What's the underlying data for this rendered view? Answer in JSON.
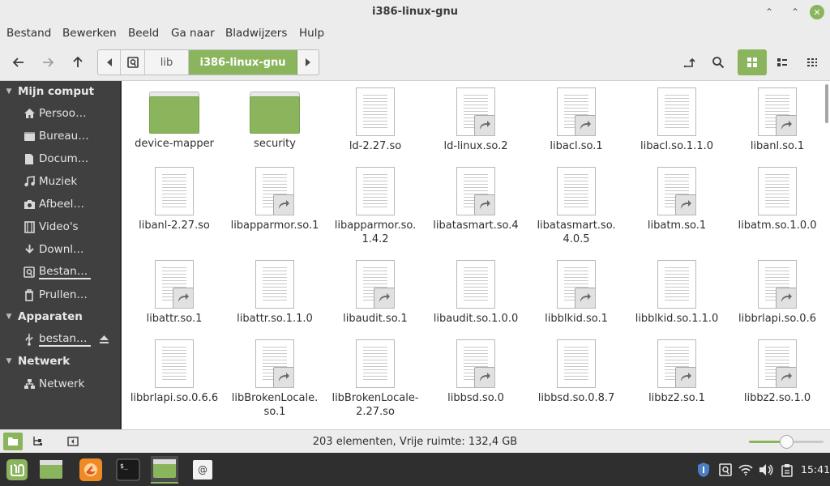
{
  "window": {
    "title": "i386-linux-gnu"
  },
  "menu": [
    "Bestand",
    "Bewerken",
    "Beeld",
    "Ga naar",
    "Bladwijzers",
    "Hulp"
  ],
  "pathbar": {
    "segments": [
      "lib",
      "i386-linux-gnu"
    ]
  },
  "sidebar": {
    "sections": [
      {
        "title": "Mijn comput",
        "items": [
          {
            "label": "Persoo…",
            "icon": "home-icon"
          },
          {
            "label": "Bureau…",
            "icon": "desktop-icon"
          },
          {
            "label": "Docum…",
            "icon": "document-icon"
          },
          {
            "label": "Muziek",
            "icon": "music-icon"
          },
          {
            "label": "Afbeel…",
            "icon": "camera-icon"
          },
          {
            "label": "Video's",
            "icon": "film-icon"
          },
          {
            "label": "Downl…",
            "icon": "download-icon"
          },
          {
            "label": "Bestan…",
            "icon": "filesystem-icon"
          },
          {
            "label": "Prullen…",
            "icon": "trash-icon"
          }
        ]
      },
      {
        "title": "Apparaten",
        "items": [
          {
            "label": "bestan…",
            "icon": "usb-icon"
          }
        ]
      },
      {
        "title": "Netwerk",
        "items": [
          {
            "label": "Netwerk",
            "icon": "network-icon"
          }
        ]
      }
    ]
  },
  "files": [
    {
      "name": "device-mapper",
      "type": "folder"
    },
    {
      "name": "security",
      "type": "folder"
    },
    {
      "name": "ld-2.27.so",
      "type": "file"
    },
    {
      "name": "ld-linux.so.2",
      "type": "link"
    },
    {
      "name": "libacl.so.1",
      "type": "link"
    },
    {
      "name": "libacl.so.1.1.0",
      "type": "file"
    },
    {
      "name": "libanl.so.1",
      "type": "link"
    },
    {
      "name": "libanl-2.27.so",
      "type": "file"
    },
    {
      "name": "libapparmor.so.1",
      "type": "link"
    },
    {
      "name": "libapparmor.so.\n1.4.2",
      "type": "file"
    },
    {
      "name": "libatasmart.so.4",
      "type": "link"
    },
    {
      "name": "libatasmart.so.\n4.0.5",
      "type": "file"
    },
    {
      "name": "libatm.so.1",
      "type": "link"
    },
    {
      "name": "libatm.so.1.0.0",
      "type": "file"
    },
    {
      "name": "libattr.so.1",
      "type": "link"
    },
    {
      "name": "libattr.so.1.1.0",
      "type": "file"
    },
    {
      "name": "libaudit.so.1",
      "type": "link"
    },
    {
      "name": "libaudit.so.1.0.0",
      "type": "file"
    },
    {
      "name": "libblkid.so.1",
      "type": "link"
    },
    {
      "name": "libblkid.so.1.1.0",
      "type": "file"
    },
    {
      "name": "libbrlapi.so.0.6",
      "type": "link"
    },
    {
      "name": "libbrlapi.so.0.6.6",
      "type": "file"
    },
    {
      "name": "libBrokenLocale.\nso.1",
      "type": "link"
    },
    {
      "name": "libBrokenLocale-\n2.27.so",
      "type": "file"
    },
    {
      "name": "libbsd.so.0",
      "type": "link"
    },
    {
      "name": "libbsd.so.0.8.7",
      "type": "file"
    },
    {
      "name": "libbz2.so.1",
      "type": "link"
    },
    {
      "name": "libbz2.so.1.0",
      "type": "link"
    }
  ],
  "status": {
    "text": "203 elementen, Vrije ruimte: 132,4 GB",
    "zoom_fraction": 0.5
  },
  "taskbar": {
    "clock": "15:41"
  },
  "colors": {
    "accent": "#8ab55d",
    "sidebar_bg": "#404040",
    "taskbar_bg": "#2f2f2f"
  }
}
